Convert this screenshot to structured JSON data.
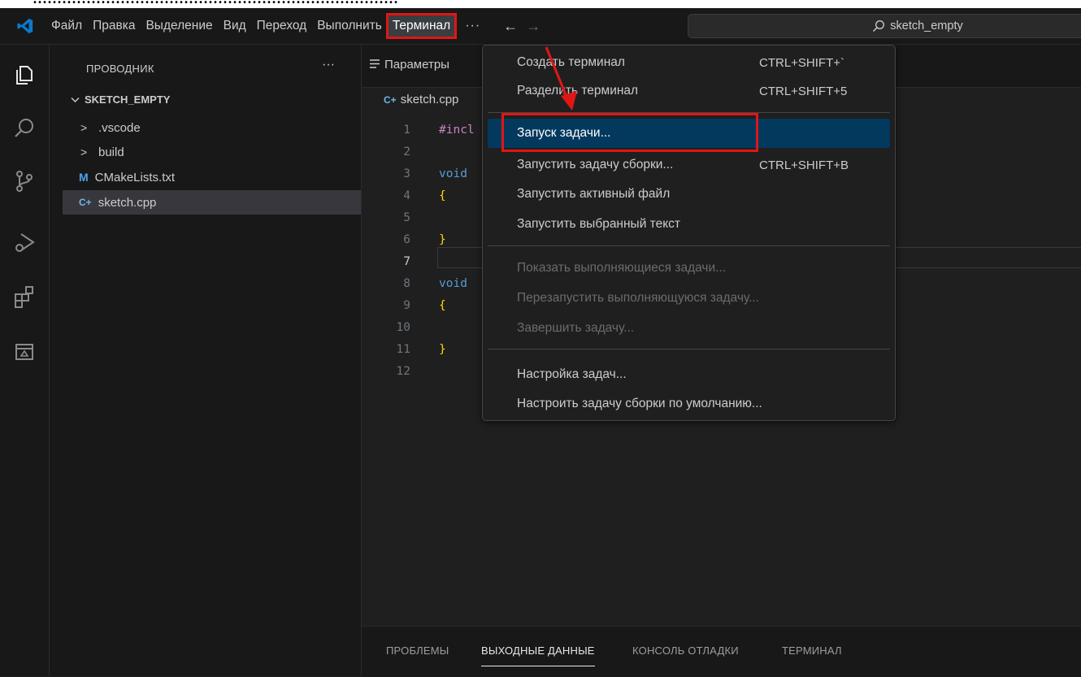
{
  "doc_strip_text": "...........................................................................",
  "menubar": {
    "items": [
      "Файл",
      "Правка",
      "Выделение",
      "Вид",
      "Переход",
      "Выполнить",
      "Терминал"
    ],
    "more": "···",
    "back_arrow": "←",
    "forward_arrow": "→"
  },
  "search": {
    "text": "sketch_empty",
    "icon": "search-icon"
  },
  "activity_icons": [
    "files-icon",
    "search-icon",
    "source-control-icon",
    "run-debug-icon",
    "extensions-icon",
    "remote-explorer-icon"
  ],
  "sidebar": {
    "title": "ПРОВОДНИК",
    "more": "···",
    "folder": "SKETCH_EMPTY",
    "items": [
      {
        "label": ".vscode",
        "kind": "folder",
        "icon": ">"
      },
      {
        "label": "build",
        "kind": "folder",
        "icon": ">"
      },
      {
        "label": "CMakeLists.txt",
        "kind": "file",
        "icon": "M"
      },
      {
        "label": "sketch.cpp",
        "kind": "file",
        "icon": "C+",
        "selected": true
      }
    ]
  },
  "editor": {
    "tab": "Параметры",
    "breadcrumb": "sketch.cpp",
    "lines": [
      {
        "n": "1",
        "text": "#incl",
        "style": "pre"
      },
      {
        "n": "2",
        "text": "",
        "style": ""
      },
      {
        "n": "3",
        "text": "void",
        "style": "kw"
      },
      {
        "n": "4",
        "text": "{",
        "style": "brace"
      },
      {
        "n": "5",
        "text": "",
        "style": ""
      },
      {
        "n": "6",
        "text": "}",
        "style": "brace"
      },
      {
        "n": "7",
        "text": "",
        "style": ""
      },
      {
        "n": "8",
        "text": "void",
        "style": "kw"
      },
      {
        "n": "9",
        "text": "{",
        "style": "brace"
      },
      {
        "n": "10",
        "text": "",
        "style": ""
      },
      {
        "n": "11",
        "text": "}",
        "style": "brace"
      },
      {
        "n": "12",
        "text": "",
        "style": ""
      }
    ]
  },
  "panel": {
    "tabs": [
      "ПРОБЛЕМЫ",
      "ВЫХОДНЫЕ ДАННЫЕ",
      "КОНСОЛЬ ОТЛАДКИ",
      "ТЕРМИНАЛ"
    ],
    "active": "ВЫХОДНЫЕ ДАННЫЕ"
  },
  "terminal_menu": {
    "items": [
      {
        "label": "Создать терминал",
        "shortcut": "CTRL+SHIFT+`"
      },
      {
        "label": "Разделить терминал",
        "shortcut": "CTRL+SHIFT+5"
      },
      {
        "label": "Запуск задачи...",
        "shortcut": "",
        "highlighted": true
      },
      {
        "label": "Запустить задачу сборки...",
        "shortcut": "CTRL+SHIFT+B"
      },
      {
        "label": "Запустить активный файл",
        "shortcut": ""
      },
      {
        "label": "Запустить выбранный текст",
        "shortcut": ""
      },
      {
        "label": "Показать выполняющиеся задачи...",
        "shortcut": "",
        "disabled": true
      },
      {
        "label": "Перезапустить выполняющуюся задачу...",
        "shortcut": "",
        "disabled": true
      },
      {
        "label": "Завершить задачу...",
        "shortcut": "",
        "disabled": true
      },
      {
        "label": "Настройка задач...",
        "shortcut": ""
      },
      {
        "label": "Настроить задачу сборки по умолчанию...",
        "shortcut": ""
      }
    ]
  },
  "colors": {
    "annotation_red": "#e01616",
    "menu_highlight": "#04395e",
    "vscode_blue": "#0a7acc"
  }
}
